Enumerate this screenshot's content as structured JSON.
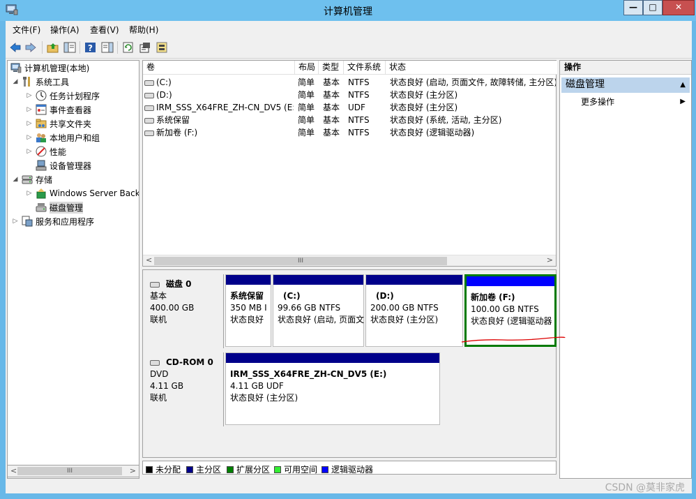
{
  "window": {
    "title": "计算机管理",
    "min_label": "—",
    "max_label": "□",
    "close_label": "✕"
  },
  "menu": [
    {
      "label": "文件(F)"
    },
    {
      "label": "操作(A)"
    },
    {
      "label": "查看(V)"
    },
    {
      "label": "帮助(H)"
    }
  ],
  "tree": {
    "root": "计算机管理(本地)",
    "system_tools": "系统工具",
    "task_scheduler": "任务计划程序",
    "event_viewer": "事件查看器",
    "shared_folders": "共享文件夹",
    "local_users": "本地用户和组",
    "performance": "性能",
    "device_manager": "设备管理器",
    "storage": "存储",
    "windows_backup": "Windows Server Back",
    "disk_management": "磁盘管理",
    "services_apps": "服务和应用程序"
  },
  "tree_scroll": {
    "left": "<",
    "thumb": "III",
    "right": ">"
  },
  "volumes": {
    "columns": [
      "卷",
      "布局",
      "类型",
      "文件系统",
      "状态"
    ],
    "rows": [
      {
        "vol": "(C:)",
        "layout": "简单",
        "type": "基本",
        "fs": "NTFS",
        "status": "状态良好 (启动, 页面文件, 故障转储, 主分区)"
      },
      {
        "vol": "(D:)",
        "layout": "简单",
        "type": "基本",
        "fs": "NTFS",
        "status": "状态良好 (主分区)"
      },
      {
        "vol": "IRM_SSS_X64FRE_ZH-CN_DV5 (E:)",
        "layout": "简单",
        "type": "基本",
        "fs": "UDF",
        "status": "状态良好 (主分区)"
      },
      {
        "vol": "系统保留",
        "layout": "简单",
        "type": "基本",
        "fs": "NTFS",
        "status": "状态良好 (系统, 活动, 主分区)"
      },
      {
        "vol": "新加卷 (F:)",
        "layout": "简单",
        "type": "基本",
        "fs": "NTFS",
        "status": "状态良好 (逻辑驱动器)"
      }
    ],
    "scroll": {
      "left": "<",
      "thumb": "III",
      "right": ">"
    }
  },
  "disks": [
    {
      "name": "磁盘 0",
      "type": "基本",
      "size": "400.00 GB",
      "state": "联机",
      "partitions": [
        {
          "title": "系统保留",
          "size": "350 MB I",
          "status": "状态良好"
        },
        {
          "title": "(C:)",
          "size": "99.66 GB NTFS",
          "status": "状态良好 (启动, 页面文"
        },
        {
          "title": "(D:)",
          "size": "200.00 GB NTFS",
          "status": "状态良好 (主分区)"
        },
        {
          "title": "新加卷  (F:)",
          "size": "100.00 GB NTFS",
          "status": "状态良好 (逻辑驱动器"
        }
      ]
    },
    {
      "name": "CD-ROM 0",
      "type": "DVD",
      "size": "4.11 GB",
      "state": "联机",
      "partitions": [
        {
          "title": "IRM_SSS_X64FRE_ZH-CN_DV5  (E:)",
          "size": "4.11 GB UDF",
          "status": "状态良好 (主分区)"
        }
      ]
    }
  ],
  "legend": [
    {
      "label": "未分配",
      "color": "#000000"
    },
    {
      "label": "主分区",
      "color": "#00008a"
    },
    {
      "label": "扩展分区",
      "color": "#008000"
    },
    {
      "label": "可用空间",
      "color": "#33ee33"
    },
    {
      "label": "逻辑驱动器",
      "color": "#0000ff"
    }
  ],
  "actions": {
    "header": "操作",
    "group": "磁盘管理",
    "more": "更多操作"
  },
  "watermark": "CSDN @莫非家虎",
  "colors": {
    "primary_partition": "#00008a",
    "logical_drive": "#0000ff",
    "highlight": "#007a00",
    "annotation": "#dd0000"
  }
}
